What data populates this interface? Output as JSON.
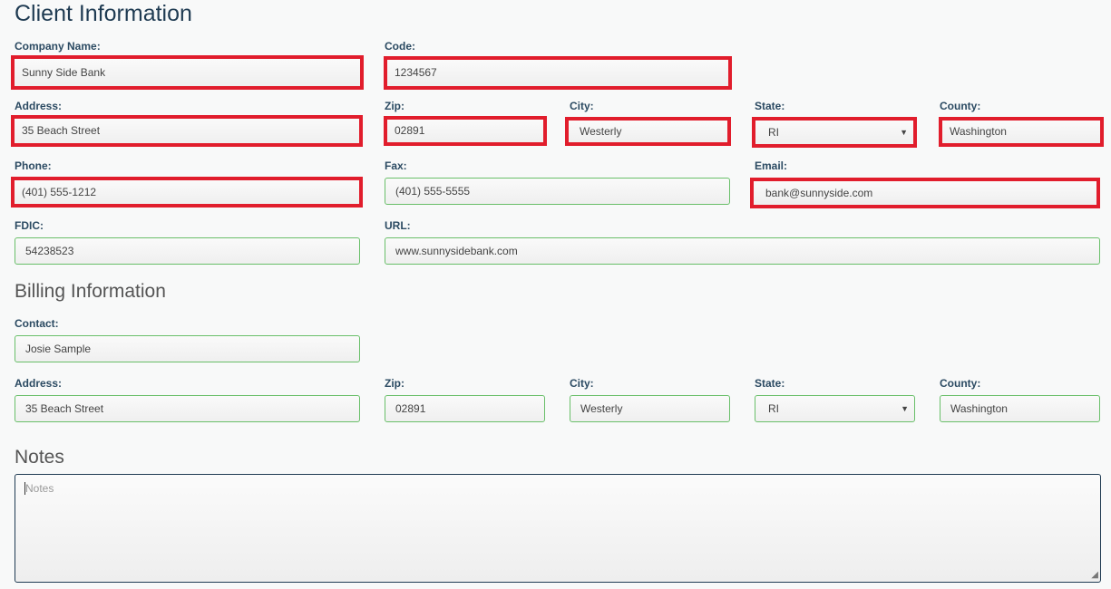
{
  "client_section": {
    "title": "Client Information",
    "company_name": {
      "label": "Company Name:",
      "value": "Sunny Side Bank"
    },
    "code": {
      "label": "Code:",
      "value": "1234567"
    },
    "address": {
      "label": "Address:",
      "value": "35 Beach Street"
    },
    "zip": {
      "label": "Zip:",
      "value": "02891"
    },
    "city": {
      "label": "City:",
      "value": "Westerly"
    },
    "state": {
      "label": "State:",
      "value": "RI"
    },
    "county": {
      "label": "County:",
      "value": "Washington"
    },
    "phone": {
      "label": "Phone:",
      "value": "(401) 555-1212"
    },
    "fax": {
      "label": "Fax:",
      "value": "(401) 555-5555"
    },
    "email": {
      "label": "Email:",
      "value": "bank@sunnyside.com"
    },
    "fdic": {
      "label": "FDIC:",
      "value": "54238523"
    },
    "url": {
      "label": "URL:",
      "value": "www.sunnysidebank.com"
    }
  },
  "billing_section": {
    "title": "Billing Information",
    "contact": {
      "label": "Contact:",
      "value": "Josie Sample"
    },
    "address": {
      "label": "Address:",
      "value": "35 Beach Street"
    },
    "zip": {
      "label": "Zip:",
      "value": "02891"
    },
    "city": {
      "label": "City:",
      "value": "Westerly"
    },
    "state": {
      "label": "State:",
      "value": "RI"
    },
    "county": {
      "label": "County:",
      "value": "Washington"
    }
  },
  "notes_section": {
    "title": "Notes",
    "placeholder": "Notes"
  },
  "colors": {
    "valid_border": "#69bf69",
    "highlight_border": "#e11d2c",
    "label_text": "#2b4a62"
  },
  "icons": {
    "select_arrow": "chevron-down-icon",
    "resize_grip": "resize-grip-icon"
  }
}
